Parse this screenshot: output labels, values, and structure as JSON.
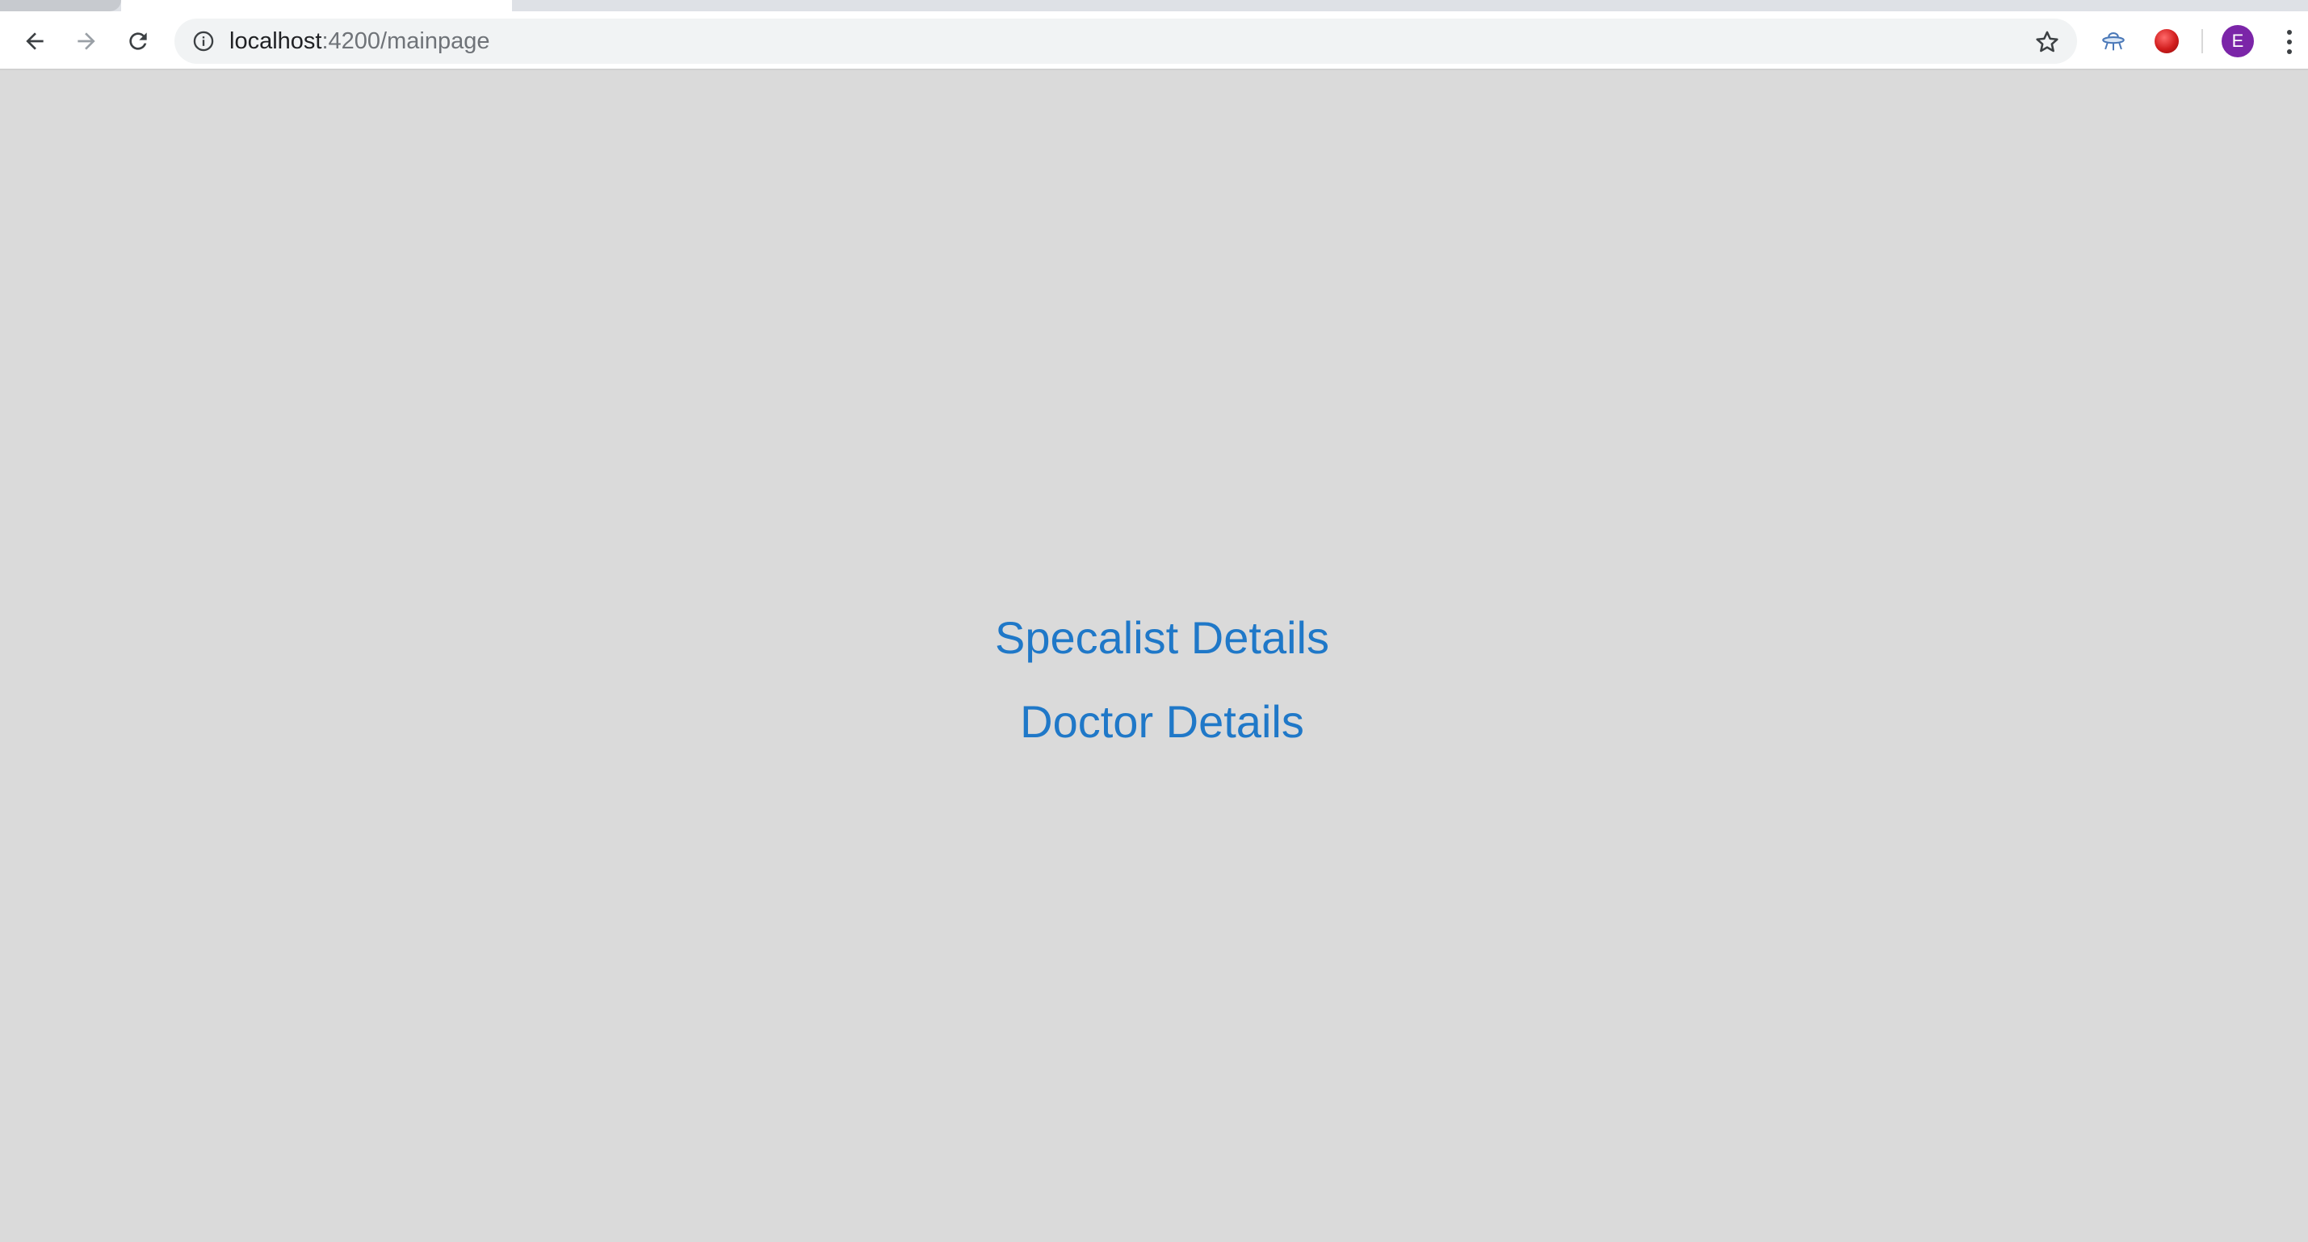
{
  "browser": {
    "url": {
      "host": "localhost",
      "path": ":4200/mainpage"
    },
    "profile_initial": "E",
    "profile_color": "#7b25a8",
    "icons": {
      "back": "arrow-left-icon",
      "forward": "arrow-right-icon",
      "reload": "reload-icon",
      "site_info": "info-icon",
      "bookmark": "star-icon",
      "extension_1": "ufo-extension-icon",
      "extension_2": "red-dot-extension-icon",
      "menu": "kebab-menu-icon"
    }
  },
  "main": {
    "links": [
      {
        "label": "Specalist Details"
      },
      {
        "label": "Doctor Details"
      }
    ],
    "link_color": "#1f78c8",
    "background": "#dadada"
  }
}
